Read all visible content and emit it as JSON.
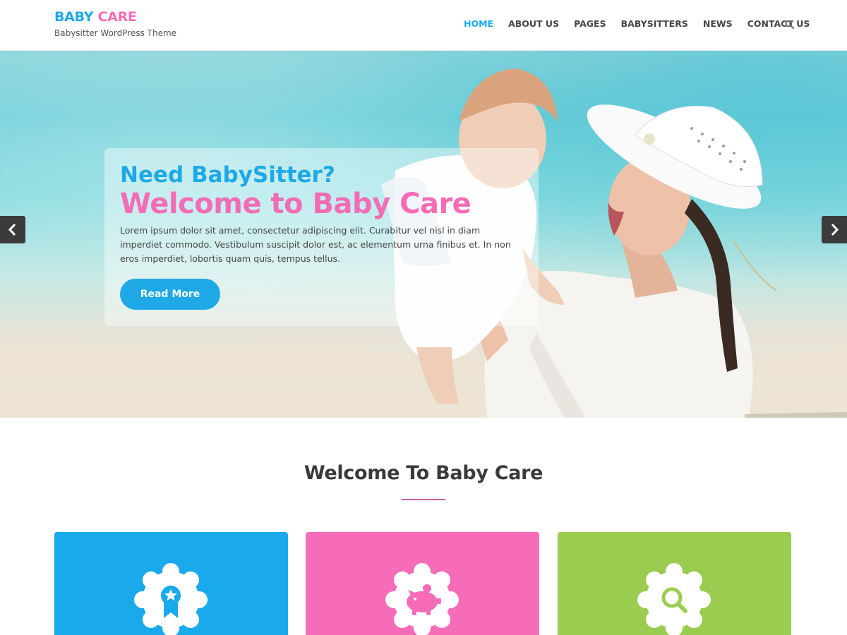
{
  "brand": {
    "word1": "BABY",
    "word2": "CARE",
    "tagline": "Babysitter WordPress Theme"
  },
  "nav": {
    "items": [
      {
        "label": "HOME",
        "active": true
      },
      {
        "label": "ABOUT US",
        "active": false
      },
      {
        "label": "PAGES",
        "active": false
      },
      {
        "label": "BABYSITTERS",
        "active": false
      },
      {
        "label": "NEWS",
        "active": false
      },
      {
        "label": "CONTACT US",
        "active": false
      }
    ],
    "search_icon": "search-icon"
  },
  "hero": {
    "subtitle": "Need BabySitter?",
    "title": "Welcome to Baby Care",
    "text": "Lorem ipsum dolor sit amet, consectetur adipiscing elit. Curabitur vel nisl in diam imperdiet commodo. Vestibulum suscipit dolor est, ac elementum urna finibus et. In non eros imperdiet, lobortis quam quis, tempus tellus.",
    "button": "Read More",
    "prev_icon": "chevron-left-icon",
    "next_icon": "chevron-right-icon"
  },
  "welcome": {
    "title": "Welcome To Baby Care"
  },
  "features": [
    {
      "icon": "award-ribbon-icon",
      "color": "#1aa9ea"
    },
    {
      "icon": "piggy-bank-icon",
      "color": "#f76cb9"
    },
    {
      "icon": "search-icon",
      "color": "#9acd4f"
    }
  ],
  "colors": {
    "blue": "#1ea9e6",
    "pink": "#f46cb5",
    "green": "#9acd4f",
    "divider": "#c8579a"
  }
}
